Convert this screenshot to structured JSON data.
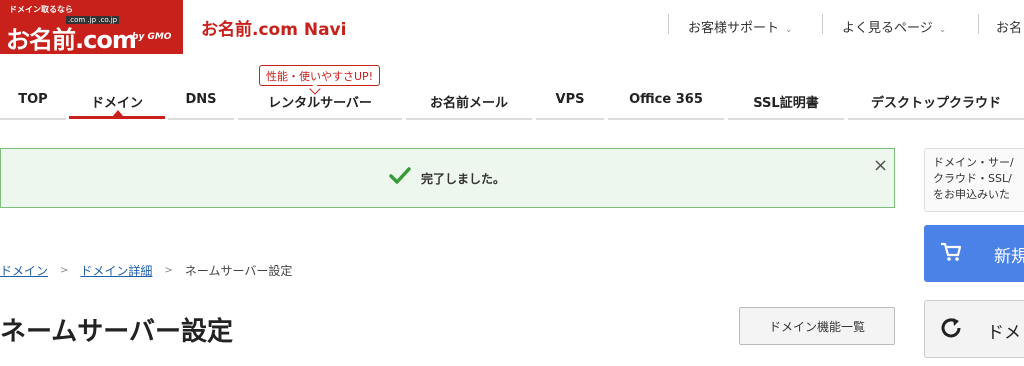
{
  "logo": {
    "tagline": "ドメイン取るなら",
    "tlds": ".com .jp .co.jp",
    "name": "お名前.com",
    "by": "by GMO"
  },
  "app_title": "お名前.com Navi",
  "header_links": [
    {
      "label": "お客様サポート"
    },
    {
      "label": "よく見るページ"
    },
    {
      "label": "お名"
    }
  ],
  "promo": "性能・使いやすさUP!",
  "nav": [
    {
      "label": "TOP"
    },
    {
      "label": "ドメイン"
    },
    {
      "label": "DNS"
    },
    {
      "label": "レンタルサーバー"
    },
    {
      "label": "お名前メール"
    },
    {
      "label": "VPS"
    },
    {
      "label": "Office 365"
    },
    {
      "label": "SSL証明書"
    },
    {
      "label": "デスクトップクラウド"
    }
  ],
  "alert": {
    "message": "完了しました。",
    "close": "×"
  },
  "breadcrumb": {
    "items": [
      "ドメイン",
      "ドメイン詳細"
    ],
    "current": "ネームサーバー設定",
    "sep": ">"
  },
  "page_title": "ネームサーバー設定",
  "func_button": "ドメイン機能一覧",
  "sidebar": {
    "note_lines": [
      "ドメイン・サー/",
      "クラウド・SSL/",
      "をお申込みいた"
    ],
    "new_button": "新規",
    "domain_button": "ドメ"
  },
  "colors": {
    "brand": "#c8201a",
    "link": "#1f5fa8",
    "success": "#3a9a3a",
    "primary": "#4a82e8"
  }
}
